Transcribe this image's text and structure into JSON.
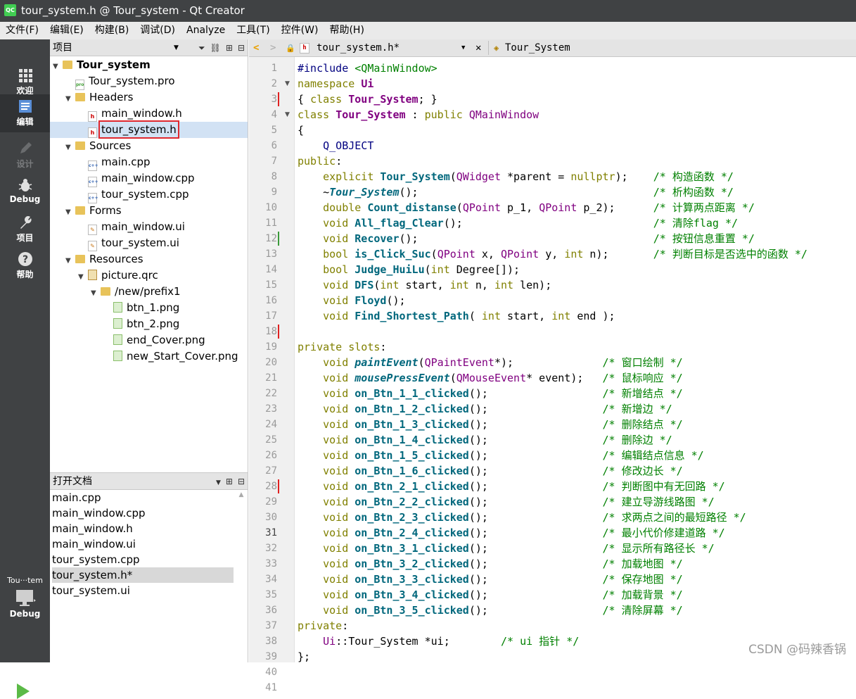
{
  "window": {
    "title": "tour_system.h @ Tour_system - Qt Creator",
    "app_icon": "QC"
  },
  "menu": [
    "文件(F)",
    "编辑(E)",
    "构建(B)",
    "调试(D)",
    "Analyze",
    "工具(T)",
    "控件(W)",
    "帮助(H)"
  ],
  "modes": [
    {
      "label": "欢迎",
      "icon": "grid-icon"
    },
    {
      "label": "编辑",
      "icon": "edit-icon"
    },
    {
      "label": "设计",
      "icon": "pen-icon"
    },
    {
      "label": "Debug",
      "icon": "bug-icon"
    },
    {
      "label": "项目",
      "icon": "wrench-icon"
    },
    {
      "label": "帮助",
      "icon": "help-icon"
    }
  ],
  "kit": {
    "name": "Tou···tem",
    "mode": "Debug"
  },
  "project_panel": {
    "title": "项目",
    "tree": [
      {
        "label": "Tour_system",
        "kind": "project",
        "bold": true
      },
      {
        "label": "Tour_system.pro",
        "kind": "pro"
      },
      {
        "label": "Headers",
        "kind": "folder"
      },
      {
        "label": "main_window.h",
        "kind": "h"
      },
      {
        "label": "tour_system.h",
        "kind": "h",
        "selected": true
      },
      {
        "label": "Sources",
        "kind": "folder"
      },
      {
        "label": "main.cpp",
        "kind": "cpp"
      },
      {
        "label": "main_window.cpp",
        "kind": "cpp"
      },
      {
        "label": "tour_system.cpp",
        "kind": "cpp"
      },
      {
        "label": "Forms",
        "kind": "folder"
      },
      {
        "label": "main_window.ui",
        "kind": "ui"
      },
      {
        "label": "tour_system.ui",
        "kind": "ui"
      },
      {
        "label": "Resources",
        "kind": "folder"
      },
      {
        "label": "picture.qrc",
        "kind": "qrc"
      },
      {
        "label": "/new/prefix1",
        "kind": "folder"
      },
      {
        "label": "btn_1.png",
        "kind": "png"
      },
      {
        "label": "btn_2.png",
        "kind": "png"
      },
      {
        "label": "end_Cover.png",
        "kind": "png"
      },
      {
        "label": "new_Start_Cover.png",
        "kind": "png"
      }
    ]
  },
  "open_docs": {
    "title": "打开文档",
    "items": [
      "main.cpp",
      "main_window.cpp",
      "main_window.h",
      "main_window.ui",
      "tour_system.cpp",
      "tour_system.h*",
      "tour_system.ui"
    ],
    "selected": "tour_system.h*"
  },
  "editor": {
    "file_tab": "tour_system.h*",
    "symbol": "Tour_System",
    "current_line": 31,
    "lines": [
      "#include <QMainWindow>",
      "namespace Ui",
      "{ class Tour_System; }",
      "class Tour_System : public QMainWindow",
      "{",
      "    Q_OBJECT",
      "public:",
      "    explicit Tour_System(QWidget *parent = nullptr);    /* 构造函数 */",
      "    ~Tour_System();                                     /* 析构函数 */",
      "    double Count_distanse(QPoint p_1, QPoint p_2);      /* 计算两点距离 */",
      "    void All_flag_Clear();                              /* 清除flag */",
      "    void Recover();                                     /* 按钮信息重置 */",
      "    bool is_Click_Suc(QPoint x, QPoint y, int n);       /* 判断目标是否选中的函数 */",
      "    bool Judge_HuiLu(int Degree[]);",
      "    void DFS(int start, int n, int len);",
      "    void Floyd();",
      "    void Find_Shortest_Path( int start, int end );",
      "",
      "private slots:",
      "    void paintEvent(QPaintEvent*);              /* 窗口绘制 */",
      "    void mousePressEvent(QMouseEvent* event);   /* 鼠标响应 */",
      "    void on_Btn_1_1_clicked();                  /* 新增结点 */",
      "    void on_Btn_1_2_clicked();                  /* 新增边 */",
      "    void on_Btn_1_3_clicked();                  /* 删除结点 */",
      "    void on_Btn_1_4_clicked();                  /* 删除边 */",
      "    void on_Btn_1_5_clicked();                  /* 编辑结点信息 */",
      "    void on_Btn_1_6_clicked();                  /* 修改边长 */",
      "    void on_Btn_2_1_clicked();                  /* 判断图中有无回路 */",
      "    void on_Btn_2_2_clicked();                  /* 建立导游线路图 */",
      "    void on_Btn_2_3_clicked();                  /* 求两点之间的最短路径 */",
      "    void on_Btn_2_4_clicked();                  /* 最小代价修建道路 */",
      "    void on_Btn_3_1_clicked();                  /* 显示所有路径长 */",
      "    void on_Btn_3_2_clicked();                  /* 加载地图 */",
      "    void on_Btn_3_3_clicked();                  /* 保存地图 */",
      "    void on_Btn_3_4_clicked();                  /* 加载背景 */",
      "    void on_Btn_3_5_clicked();                  /* 清除屏幕 */",
      "private:",
      "    Ui::Tour_System *ui;        /* ui 指针 */",
      "};",
      "",
      ""
    ]
  },
  "watermark": "CSDN @码辣香锅"
}
